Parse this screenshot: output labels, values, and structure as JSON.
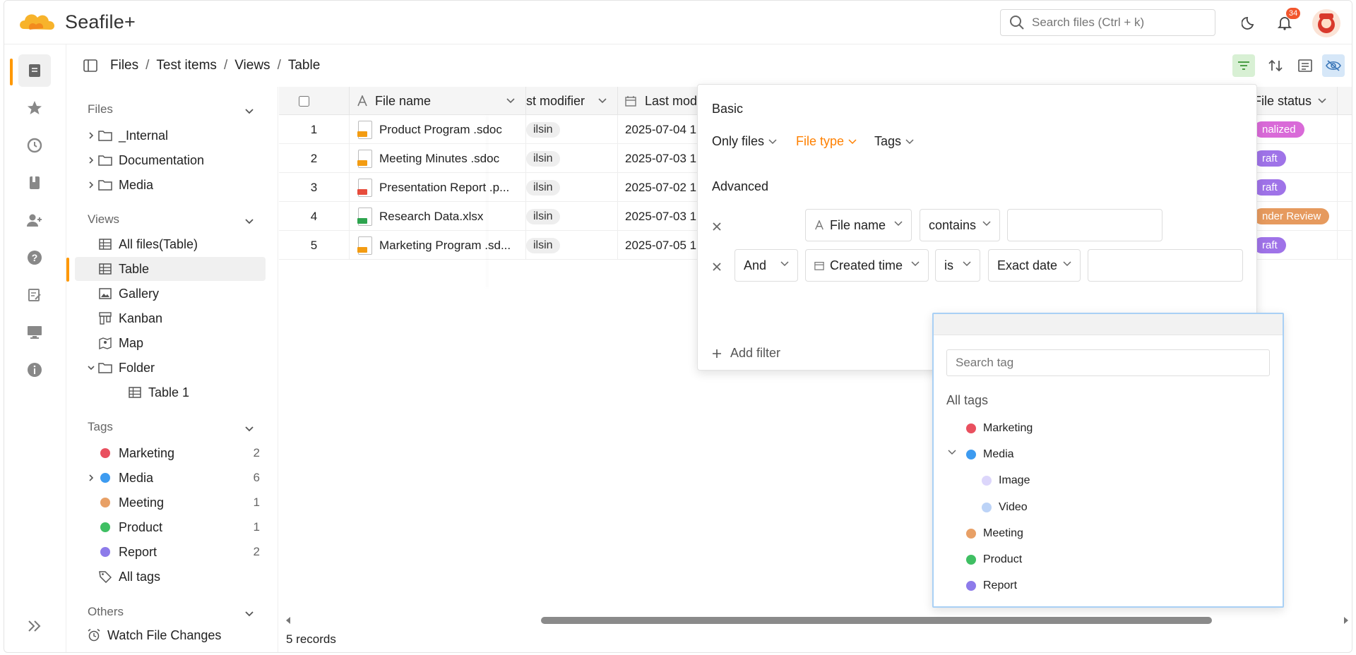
{
  "app": {
    "name": "Seafile+"
  },
  "header": {
    "search_placeholder": "Search files (Ctrl + k)",
    "notification_count": "34"
  },
  "breadcrumb": [
    "Files",
    "Test items",
    "Views",
    "Table"
  ],
  "sidebar": {
    "files_title": "Files",
    "files": [
      "_Internal",
      "Documentation",
      "Media"
    ],
    "views_title": "Views",
    "views": [
      "All files(Table)",
      "Table",
      "Gallery",
      "Kanban",
      "Map",
      "Folder",
      "Table 1"
    ],
    "tags_title": "Tags",
    "tags": [
      {
        "name": "Marketing",
        "count": "2",
        "color": "#e9505f"
      },
      {
        "name": "Media",
        "count": "6",
        "color": "#3d9bf0"
      },
      {
        "name": "Meeting",
        "count": "1",
        "color": "#e8a066"
      },
      {
        "name": "Product",
        "count": "1",
        "color": "#3fbf63"
      },
      {
        "name": "Report",
        "count": "2",
        "color": "#8d7bea"
      }
    ],
    "all_tags": "All tags",
    "others_title": "Others",
    "watch_file_changes": "Watch File Changes"
  },
  "table": {
    "headers": {
      "file_name": "File name",
      "last_modifier": "st modifier",
      "last_modified": "Last modi",
      "file_status": "File status"
    },
    "rows": [
      {
        "num": "1",
        "name": "Product Program .sdoc",
        "modifier": "ilsin",
        "modified": "2025-07-04 1",
        "status": "nalized",
        "status_color": "#d96ad8",
        "ext": "SDOC",
        "ext_color": "#f39c12"
      },
      {
        "num": "2",
        "name": "Meeting Minutes .sdoc",
        "modifier": "ilsin",
        "modified": "2025-07-03 1",
        "status": "raft",
        "status_color": "#9f73e8",
        "ext": "SDOC",
        "ext_color": "#f39c12"
      },
      {
        "num": "3",
        "name": "Presentation Report .p...",
        "modifier": "ilsin",
        "modified": "2025-07-02 1",
        "status": "raft",
        "status_color": "#9f73e8",
        "ext": "PPT",
        "ext_color": "#e74c3c"
      },
      {
        "num": "4",
        "name": "Research Data.xlsx",
        "modifier": "ilsin",
        "modified": "2025-07-03 1",
        "status": "nder Review",
        "status_color": "#e69a5e",
        "ext": "XLS",
        "ext_color": "#2ea44f"
      },
      {
        "num": "5",
        "name": "Marketing Program .sd...",
        "modifier": "ilsin",
        "modified": "2025-07-05 1",
        "status": "raft",
        "status_color": "#9f73e8",
        "ext": "SDOC",
        "ext_color": "#f39c12"
      }
    ],
    "records_label": "5 records"
  },
  "filter": {
    "basic_title": "Basic",
    "only_files": "Only files",
    "file_type": "File type",
    "tags": "Tags",
    "advanced_title": "Advanced",
    "row1": {
      "column": "File name",
      "operator": "contains"
    },
    "row2": {
      "conjunction": "And",
      "column": "Created time",
      "operator": "is",
      "term": "Exact date"
    },
    "add_filter": "Add filter"
  },
  "tag_dropdown": {
    "search_placeholder": "Search tag",
    "all_tags": "All tags",
    "items": [
      {
        "name": "Marketing",
        "color": "#e9505f"
      },
      {
        "name": "Media",
        "color": "#3d9bf0"
      },
      {
        "name": "Image",
        "color": "#dcd6fb"
      },
      {
        "name": "Video",
        "color": "#bcd3f7"
      },
      {
        "name": "Meeting",
        "color": "#e8a066"
      },
      {
        "name": "Product",
        "color": "#3fbf63"
      },
      {
        "name": "Report",
        "color": "#8d7bea"
      }
    ]
  }
}
